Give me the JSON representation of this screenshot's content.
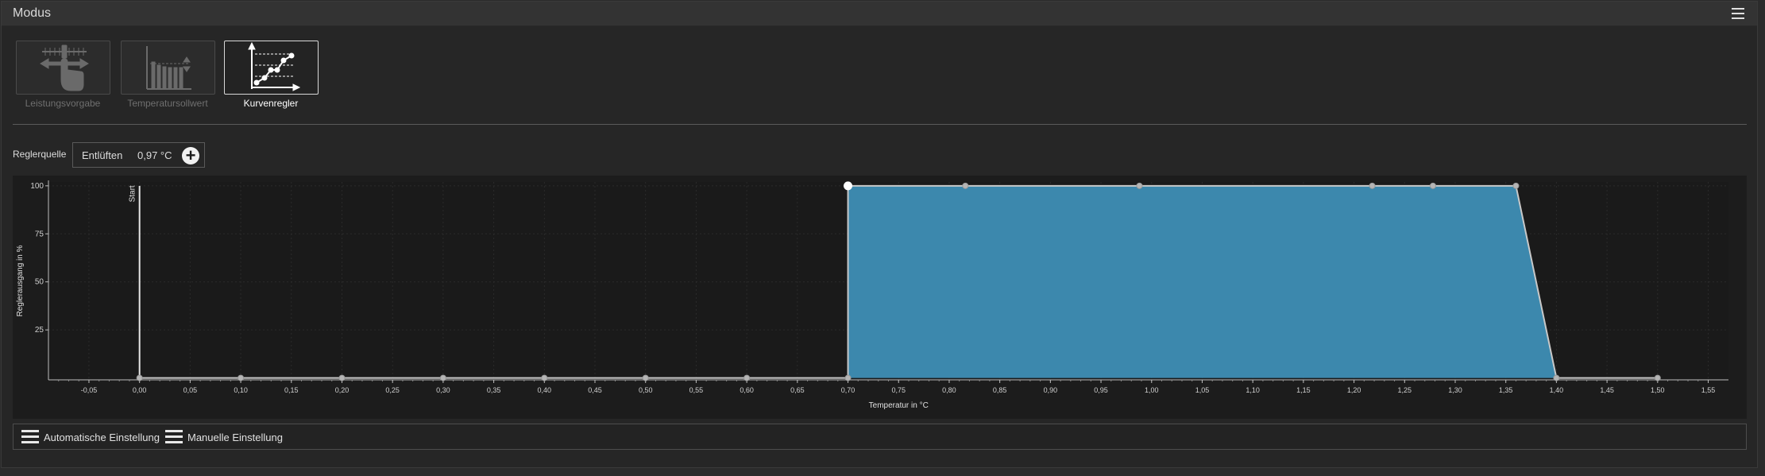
{
  "window": {
    "title": "Modus"
  },
  "modes": [
    {
      "label": "Leistungsvorgabe",
      "icon": "manual-slider-hand-icon",
      "active": false
    },
    {
      "label": "Temperatursollwert",
      "icon": "setpoint-bars-icon",
      "active": false
    },
    {
      "label": "Kurvenregler",
      "icon": "curve-controller-icon",
      "active": true
    }
  ],
  "source": {
    "label": "Reglerquelle",
    "name": "Entlüften",
    "value": "0,97 °C",
    "add_icon": "plus-circle-icon"
  },
  "chart_data": {
    "type": "area",
    "xlabel": "Temperatur in °C",
    "ylabel": "Reglerausgang in %",
    "xlim": [
      -0.09,
      1.57
    ],
    "ylim": [
      -1,
      102
    ],
    "x_ticks": [
      -0.05,
      0.0,
      0.05,
      0.1,
      0.15,
      0.2,
      0.25,
      0.3,
      0.35,
      0.4,
      0.45,
      0.5,
      0.55,
      0.6,
      0.65,
      0.7,
      0.75,
      0.8,
      0.85,
      0.9,
      0.95,
      1.0,
      1.05,
      1.1,
      1.15,
      1.2,
      1.25,
      1.3,
      1.35,
      1.4,
      1.45,
      1.5,
      1.55
    ],
    "x_tick_labels": [
      "-0,05",
      "0,00",
      "0,05",
      "0,10",
      "0,15",
      "0,20",
      "0,25",
      "0,30",
      "0,35",
      "0,40",
      "0,45",
      "0,50",
      "0,55",
      "0,60",
      "0,65",
      "0,70",
      "0,75",
      "0,80",
      "0,85",
      "0,90",
      "0,95",
      "1,00",
      "1,05",
      "1,10",
      "1,15",
      "1,20",
      "1,25",
      "1,30",
      "1,35",
      "1,40",
      "1,45",
      "1,50",
      "1,55"
    ],
    "y_ticks": [
      25,
      50,
      75,
      100
    ],
    "y_tick_labels": [
      "25",
      "50",
      "75",
      "100"
    ],
    "start_marker": {
      "x": 0.0,
      "label": "Start"
    },
    "series": [
      {
        "points": [
          [
            0.0,
            0
          ],
          [
            0.1,
            0
          ],
          [
            0.2,
            0
          ],
          [
            0.3,
            0
          ],
          [
            0.4,
            0
          ],
          [
            0.5,
            0
          ],
          [
            0.6,
            0
          ],
          [
            0.7,
            0
          ],
          [
            0.7,
            100
          ],
          [
            0.816,
            100
          ],
          [
            0.988,
            100
          ],
          [
            1.218,
            100
          ],
          [
            1.278,
            100
          ],
          [
            1.36,
            100
          ],
          [
            1.4,
            0
          ],
          [
            1.5,
            0
          ]
        ],
        "highlight_index": 8,
        "fill_color": "#3c88ad",
        "line_color": "#c8c8c8"
      }
    ]
  },
  "bottom": {
    "auto_label": "Automatische Einstellung",
    "manual_label": "Manuelle Einstellung"
  },
  "colors": {
    "background": "#262626",
    "plot_bg": "#1c1c1c",
    "accent": "#3c88ad"
  }
}
